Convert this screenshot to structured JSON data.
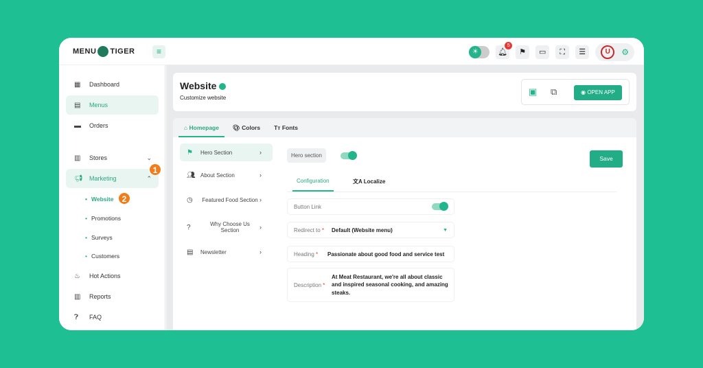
{
  "brand": {
    "logo": "MENU TIGER"
  },
  "header": {
    "notifications_count": "5",
    "avatar_letter": "U"
  },
  "sidebar": {
    "items": [
      {
        "label": "Dashboard"
      },
      {
        "label": "Menus"
      },
      {
        "label": "Orders"
      },
      {
        "label": "Stores"
      },
      {
        "label": "Marketing"
      },
      {
        "label": "Hot Actions"
      },
      {
        "label": "Reports"
      },
      {
        "label": "FAQ"
      }
    ],
    "marketing_sub": [
      {
        "label": "Website"
      },
      {
        "label": "Promotions"
      },
      {
        "label": "Surveys"
      },
      {
        "label": "Customers"
      }
    ],
    "markers": [
      "1",
      "2"
    ]
  },
  "page": {
    "title": "Website",
    "subtitle": "Customize website",
    "open_app": "OPEN APP"
  },
  "tabs": [
    {
      "label": "Homepage"
    },
    {
      "label": "Colors"
    },
    {
      "label": "Fonts"
    }
  ],
  "sections": [
    {
      "label": "Hero Section"
    },
    {
      "label": "About Section"
    },
    {
      "label": "Featured Food Section"
    },
    {
      "label": "Why Choose Us Section"
    },
    {
      "label": "Newsletter"
    }
  ],
  "editor": {
    "hero_label": "Hero section",
    "hero_enabled": true,
    "save": "Save",
    "subtabs": [
      {
        "label": "Configuration"
      },
      {
        "label": "Localize"
      }
    ],
    "button_link": {
      "label": "Button Link",
      "enabled": true
    },
    "redirect": {
      "label": "Redirect to",
      "value": "Default (Website menu)"
    },
    "heading": {
      "label": "Heading",
      "value": "Passionate about good food and service test"
    },
    "description": {
      "label": "Description",
      "value": "At Meat Restaurant, we're all about classic and inspired seasonal cooking, and amazing steaks."
    }
  },
  "colors": {
    "accent": "#22b58b",
    "background": "#1fbf94",
    "marker": "#f07d1a"
  }
}
